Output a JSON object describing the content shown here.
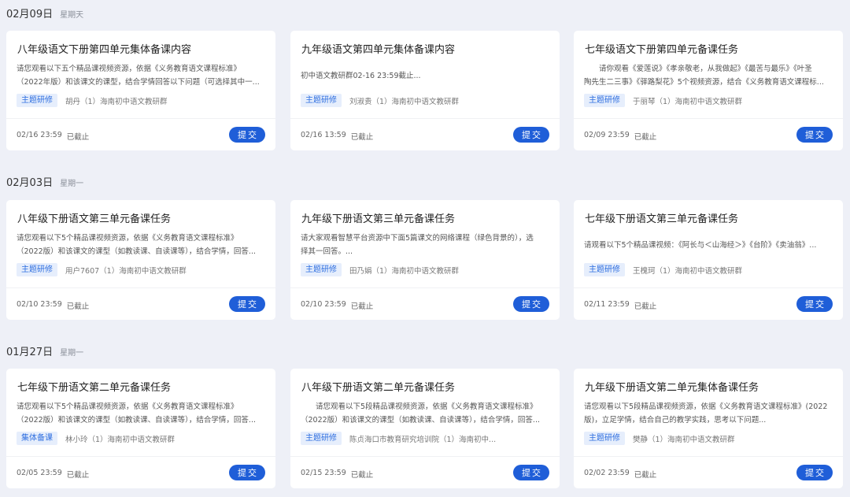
{
  "groups": [
    {
      "date": "02月09日",
      "weekday": "星期天",
      "cards": [
        {
          "title": "八年级语文下册第四单元集体备课内容",
          "desc": [
            "请您观看以下五个精品课视频资源，依据《义务教育语文课程标准》",
            "（2022年版）和该课文的课型，结合学情回答以下问题（可选择其中一..."
          ],
          "tag": "主题研修",
          "meta": "胡丹（1）海南初中语文教研群",
          "deadline_date": "02/16 23:59",
          "status": "已截止",
          "button": "提交"
        },
        {
          "title": "九年级语文第四单元集体备课内容",
          "desc": [
            "初中语文教研群02-16 23:59截止..."
          ],
          "tag": "主题研修",
          "meta": "刘淑贵（1）海南初中语文教研群",
          "deadline_date": "02/16 13:59",
          "status": "已截止",
          "button": "提交"
        },
        {
          "title": "七年级语文下册第四单元备课任务",
          "desc": [
            "　　请你观看《爱莲说》《孝亲敬老，从我做起》《最苦与最乐》《叶圣",
            "陶先生二三事》《驿路梨花》5个视频资源，结合《义务教育语文课程标..."
          ],
          "tag": "主题研修",
          "meta": "于丽琴（1）海南初中语文教研群",
          "deadline_date": "02/09 23:59",
          "status": "已截止",
          "button": "提交"
        }
      ]
    },
    {
      "date": "02月03日",
      "weekday": "星期一",
      "cards": [
        {
          "title": "八年级下册语文第三单元备课任务",
          "desc": [
            "请您观看以下5个精品课视频资源，依据《义务教育语文课程标准》",
            "（2022版）和该课文的课型（如教读课、自读课等），结合学情，回答..."
          ],
          "tag": "主题研修",
          "meta": "用户7607（1）海南初中语文教研群",
          "deadline_date": "02/10 23:59",
          "status": "已截止",
          "button": "提交"
        },
        {
          "title": "九年级下册语文第三单元备课任务",
          "desc": [
            "请大家观看智慧平台资源中下面5篇课文的网络课程（绿色背景的），选",
            "择其一回答。..."
          ],
          "tag": "主题研修",
          "meta": "田乃娟（1）海南初中语文教研群",
          "deadline_date": "02/10 23:59",
          "status": "已截止",
          "button": "提交"
        },
        {
          "title": "七年级下册语文第三单元备课任务",
          "desc": [
            "请观看以下5个精品课视频：《阿长与＜山海经＞》《台阶》《卖油翁》..."
          ],
          "tag": "主题研修",
          "meta": "王槐珂（1）海南初中语文教研群",
          "deadline_date": "02/11 23:59",
          "status": "已截止",
          "button": "提交"
        }
      ]
    },
    {
      "date": "01月27日",
      "weekday": "星期一",
      "cards": [
        {
          "title": "七年级下册语文第二单元备课任务",
          "desc": [
            "请您观看以下5个精品课视频资源，依据《义务教育语文课程标准》",
            "（2022版）和该课文的课型（如教读课、自读课等），结合学情，回答..."
          ],
          "tag": "集体备课",
          "meta": "林小玲（1）海南初中语文教研群",
          "deadline_date": "02/05 23:59",
          "status": "已截止",
          "button": "提交"
        },
        {
          "title": "八年级下册语文第二单元备课任务",
          "desc": [
            "　　请您观看以下5段精品课视频资源，依据《义务教育语文课程标准》",
            "（2022版）和该课文的课型（如教读课、自读课等），结合学情，回答..."
          ],
          "tag": "主题研修",
          "meta": "陈贞海口市教育研究培训院（1）海南初中...",
          "deadline_date": "02/15 23:59",
          "status": "已截止",
          "button": "提交"
        },
        {
          "title": "九年级下册语文第二单元集体备课任务",
          "desc": [
            "请您观看以下5段精品课视频资源，依据《义务教育语文课程标准》(2022",
            "版)，立足学情，结合自己的教学实践，思考以下问题..."
          ],
          "tag": "主题研修",
          "meta": "樊静（1）海南初中语文教研群",
          "deadline_date": "02/02 23:59",
          "status": "已截止",
          "button": "提交"
        }
      ]
    }
  ]
}
